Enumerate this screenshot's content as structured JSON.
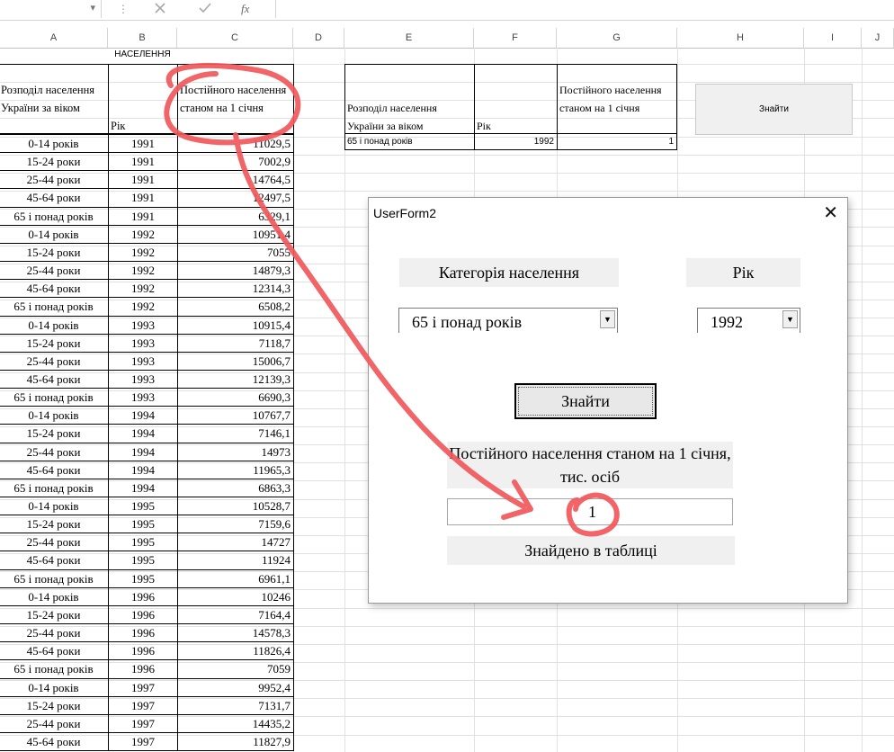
{
  "formula_bar": {
    "cancel_icon": "close-icon",
    "enter_icon": "check-icon",
    "function_label": "fx",
    "dropdown": "▾",
    "dots": "⋮"
  },
  "columns": [
    "A",
    "B",
    "C",
    "D",
    "E",
    "F",
    "G",
    "H",
    "I",
    "J"
  ],
  "sheet": {
    "header_b": "НАСЕЛЕННЯ",
    "col_a_header": "Розподіл населення України за віком",
    "col_b_header": "Рік",
    "col_c_header": "Постійного населення станом на 1 січня",
    "rows": [
      [
        "0-14 років",
        "1991",
        "11029,5"
      ],
      [
        "15-24 роки",
        "1991",
        "7002,9"
      ],
      [
        "25-44 роки",
        "1991",
        "14764,5"
      ],
      [
        "45-64 роки",
        "1991",
        "12497,5"
      ],
      [
        "65 і понад років",
        "1991",
        "6329,1"
      ],
      [
        "0-14 років",
        "1992",
        "10951,4"
      ],
      [
        "15-24 роки",
        "1992",
        "7055"
      ],
      [
        "25-44 роки",
        "1992",
        "14879,3"
      ],
      [
        "45-64 роки",
        "1992",
        "12314,3"
      ],
      [
        "65 і понад років",
        "1992",
        "6508,2"
      ],
      [
        "0-14 років",
        "1993",
        "10915,4"
      ],
      [
        "15-24 роки",
        "1993",
        "7118,7"
      ],
      [
        "25-44 роки",
        "1993",
        "15006,7"
      ],
      [
        "45-64 роки",
        "1993",
        "12139,3"
      ],
      [
        "65 і понад років",
        "1993",
        "6690,3"
      ],
      [
        "0-14 років",
        "1994",
        "10767,7"
      ],
      [
        "15-24 роки",
        "1994",
        "7146,1"
      ],
      [
        "25-44 роки",
        "1994",
        "14973"
      ],
      [
        "45-64 роки",
        "1994",
        "11965,3"
      ],
      [
        "65 і понад років",
        "1994",
        "6863,3"
      ],
      [
        "0-14 років",
        "1995",
        "10528,7"
      ],
      [
        "15-24 роки",
        "1995",
        "7159,6"
      ],
      [
        "25-44 роки",
        "1995",
        "14727"
      ],
      [
        "45-64 роки",
        "1995",
        "11924"
      ],
      [
        "65 і понад років",
        "1995",
        "6961,1"
      ],
      [
        "0-14 років",
        "1996",
        "10246"
      ],
      [
        "15-24 роки",
        "1996",
        "7164,4"
      ],
      [
        "25-44 роки",
        "1996",
        "14578,3"
      ],
      [
        "45-64 роки",
        "1996",
        "11826,4"
      ],
      [
        "65 і понад років",
        "1996",
        "7059"
      ],
      [
        "0-14 років",
        "1997",
        "9952,4"
      ],
      [
        "15-24 роки",
        "1997",
        "7131,7"
      ],
      [
        "25-44 роки",
        "1997",
        "14435,2"
      ],
      [
        "45-64 роки",
        "1997",
        "11827,9"
      ]
    ],
    "result_table": {
      "h_e": "Розподіл населення України за віком",
      "h_f": "Рік",
      "h_g": "Постійного населення станом на 1 січня",
      "v_e": "65 і понад років",
      "v_f": "1992",
      "v_g": "1"
    },
    "find_button_label": "Знайти"
  },
  "userform": {
    "title": "UserForm2",
    "close": "✕",
    "category_label": "Категорія населення",
    "year_label": "Рік",
    "category_value": "65 і понад років",
    "year_value": "1992",
    "dropdown_arrow": "▼",
    "find_label": "Знайти",
    "result_label": "Постійного населення станом на 1 січня, тис. осіб",
    "result_value": "1",
    "found_label": "Знайдено в таблиці"
  },
  "annotation": {
    "color": "#f0585c"
  }
}
